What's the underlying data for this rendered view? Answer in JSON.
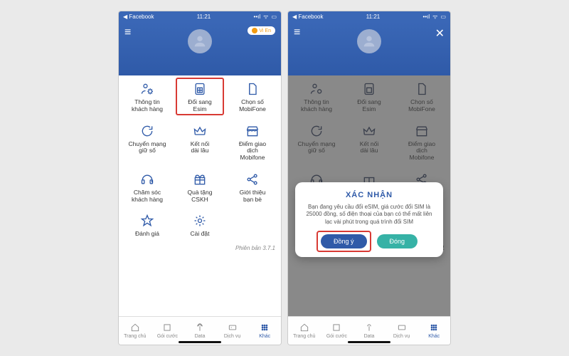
{
  "status": {
    "back": "◀ Facebook",
    "time": "11:21",
    "signal": "📶",
    "wifi": "⎋",
    "battery": "▮"
  },
  "header": {
    "lang": "Vi En"
  },
  "tiles": [
    {
      "id": "customer-info",
      "label": "Thông tin\nkhách hàng"
    },
    {
      "id": "switch-esim",
      "label": "Đổi sang\nEsim",
      "highlight": true
    },
    {
      "id": "choose-number",
      "label": "Chọn số\nMobiFone"
    },
    {
      "id": "keep-number",
      "label": "Chuyển mạng\ngiữ số"
    },
    {
      "id": "long-connect",
      "label": "Kết nối\ndài lâu"
    },
    {
      "id": "stores",
      "label": "Điểm giao\ndịch\nMobifone"
    },
    {
      "id": "care",
      "label": "Chăm sóc\nkhách hàng"
    },
    {
      "id": "gifts",
      "label": "Quà tặng\nCSKH"
    },
    {
      "id": "share",
      "label": "Giới thiệu\nbạn bè"
    },
    {
      "id": "rate",
      "label": "Đánh giá"
    },
    {
      "id": "settings",
      "label": "Cài đặt"
    }
  ],
  "version": "Phiên bản 3.7.1",
  "tabs": [
    {
      "id": "home",
      "label": "Trang chủ"
    },
    {
      "id": "plans",
      "label": "Gói cước"
    },
    {
      "id": "data",
      "label": "Data"
    },
    {
      "id": "services",
      "label": "Dịch vụ"
    },
    {
      "id": "other",
      "label": "Khác",
      "active": true
    }
  ],
  "modal": {
    "title": "XÁC NHẬN",
    "body": "Bạn đang yêu cầu đổi eSIM, giá cước đổi SIM là 25000 đồng, số điện thoại của bạn có thể mất liên lạc vài phút trong quá trình đổi SIM",
    "agree": "Đồng ý",
    "close": "Đóng"
  }
}
